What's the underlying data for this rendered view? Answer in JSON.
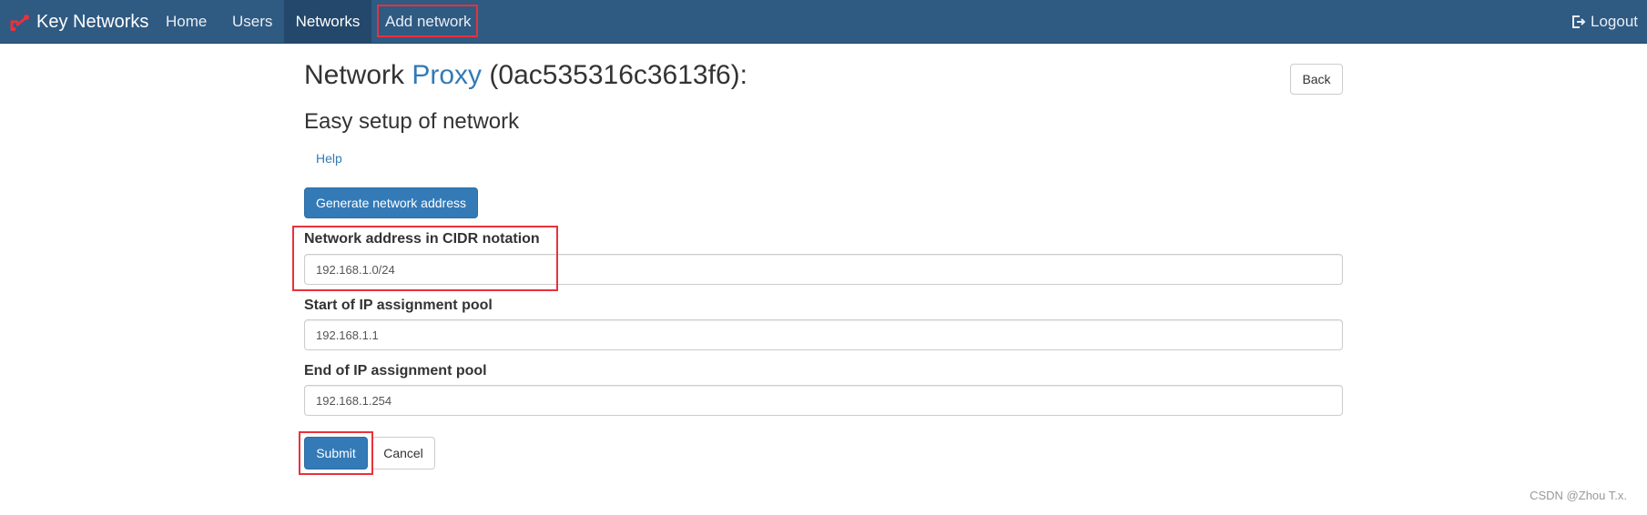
{
  "navbar": {
    "brand": "Key Networks",
    "brand_icon": "key-networks-logo-icon",
    "items": [
      {
        "label": "Home"
      },
      {
        "label": "Users"
      },
      {
        "label": "Networks"
      },
      {
        "label": "Add network"
      }
    ],
    "logout_label": "Logout",
    "logout_icon": "logout-icon",
    "color": "#2f5a82"
  },
  "page": {
    "title_prefix": "Network",
    "title_name": "Proxy",
    "title_id": "(0ac535316c3613f6):",
    "back_label": "Back",
    "subtitle": "Easy setup of network",
    "help_label": "Help",
    "generate_label": "Generate network address"
  },
  "form": {
    "fields": [
      {
        "label": "Network address in CIDR notation",
        "value": "192.168.1.0/24"
      },
      {
        "label": "Start of IP assignment pool",
        "value": "192.168.1.1"
      },
      {
        "label": "End of IP assignment pool",
        "value": "192.168.1.254"
      }
    ],
    "submit_label": "Submit",
    "cancel_label": "Cancel"
  },
  "watermark": "CSDN @Zhou T.x.",
  "colors": {
    "accent": "#337ab7",
    "highlight": "#e8323c"
  }
}
